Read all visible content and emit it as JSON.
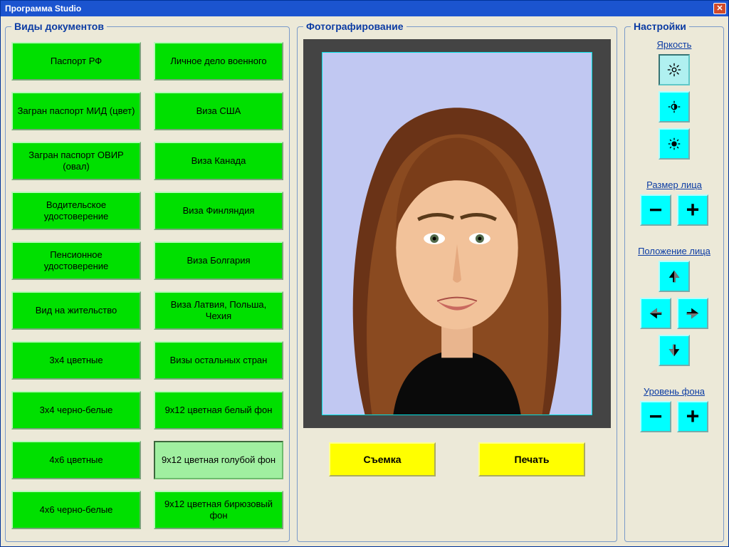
{
  "window": {
    "title": "Программа Studio"
  },
  "docs": {
    "title": "Виды документов",
    "col1": [
      "Паспорт РФ",
      "Загран паспорт МИД (цвет)",
      "Загран паспорт ОВИР (овал)",
      "Водительское удостоверение",
      "Пенсионное удостоверение",
      "Вид на жительство",
      "3x4 цветные",
      "3x4 черно-белые",
      "4x6 цветные",
      "4x6 черно-белые"
    ],
    "col2": [
      "Личное дело военного",
      "Виза США",
      "Виза Канада",
      "Виза Финляндия",
      "Виза Болгария",
      "Виза Латвия, Польша, Чехия",
      "Визы остальных стран",
      "9x12 цветная белый фон",
      "9x12 цветная голубой фон",
      "9x12 цветная бирюзовый фон"
    ],
    "selected_index": 18
  },
  "photo": {
    "title": "Фотографирование",
    "capture_label": "Съемка",
    "print_label": "Печать"
  },
  "settings": {
    "title": "Настройки",
    "brightness_label": "Яркость",
    "face_size_label": "Размер лица",
    "face_pos_label": "Положение лица",
    "bg_level_label": "Уровень фона",
    "brightness_selected": 0
  },
  "colors": {
    "doc_btn": "#00e000",
    "doc_btn_selected": "#a0efa0",
    "action_btn": "#ffff00",
    "tool_btn": "#00ffff",
    "heading": "#0b3ba3",
    "titlebar": "#1b54cf"
  }
}
